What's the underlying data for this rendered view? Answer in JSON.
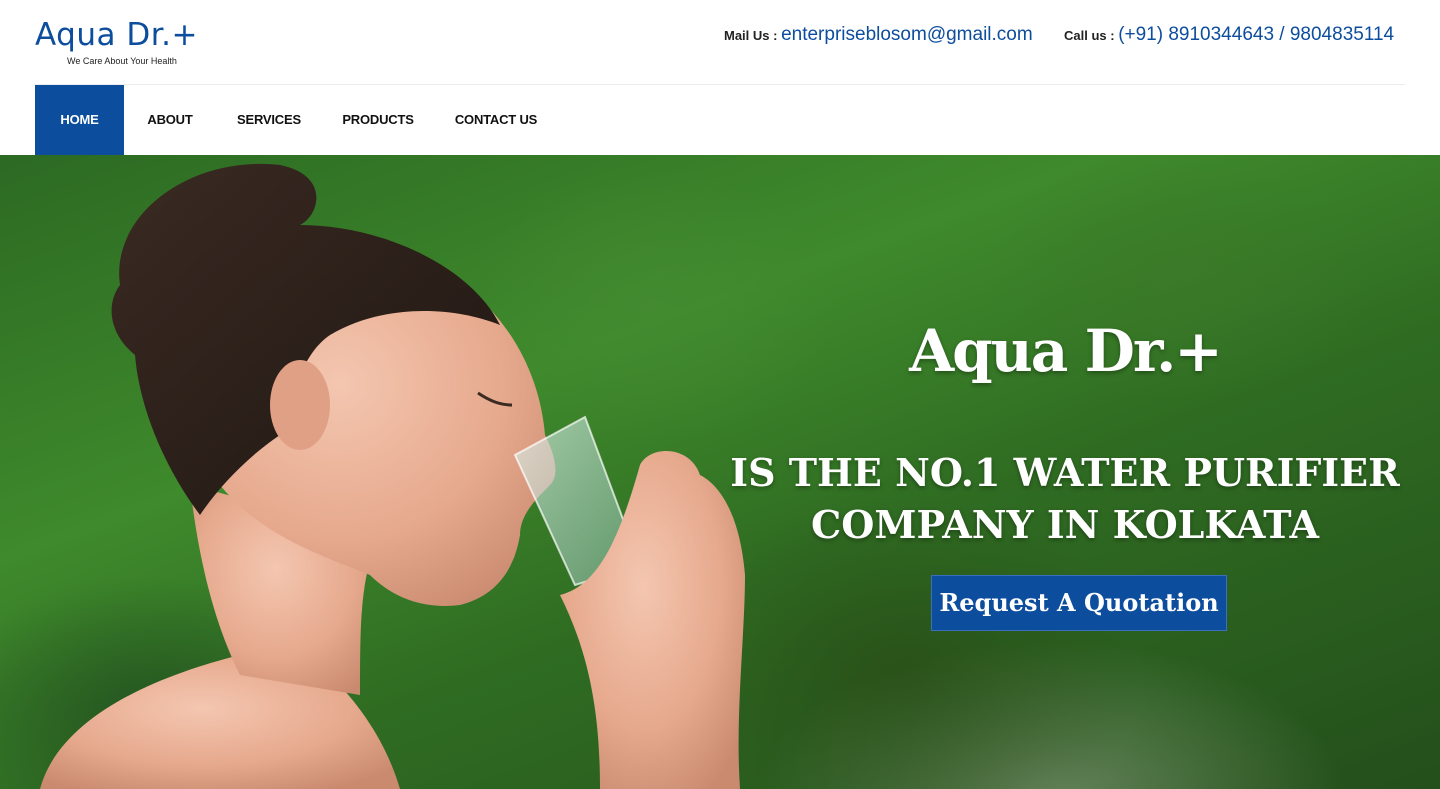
{
  "brand": {
    "name": "Aqua Dr.+",
    "tagline": "We Care About Your Health",
    "color": "#0c4d9e"
  },
  "header": {
    "mail_label": "Mail Us : ",
    "mail_value": "enterpriseblosom@gmail.com",
    "call_label": "Call us : ",
    "call_value": "(+91) 8910344643 / 9804835114"
  },
  "nav": {
    "items": [
      {
        "label": "HOME",
        "active": true
      },
      {
        "label": "ABOUT",
        "active": false
      },
      {
        "label": "SERVICES",
        "active": false
      },
      {
        "label": "PRODUCTS",
        "active": false
      },
      {
        "label": "CONTACT US",
        "active": false
      }
    ]
  },
  "hero": {
    "title": "Aqua Dr.+",
    "tagline_line1": "IS THE NO.1 WATER PURIFIER",
    "tagline_line2": "COMPANY IN KOLKATA",
    "cta_label": "Request A Quotation",
    "image_subject": "woman drinking a glass of water"
  }
}
